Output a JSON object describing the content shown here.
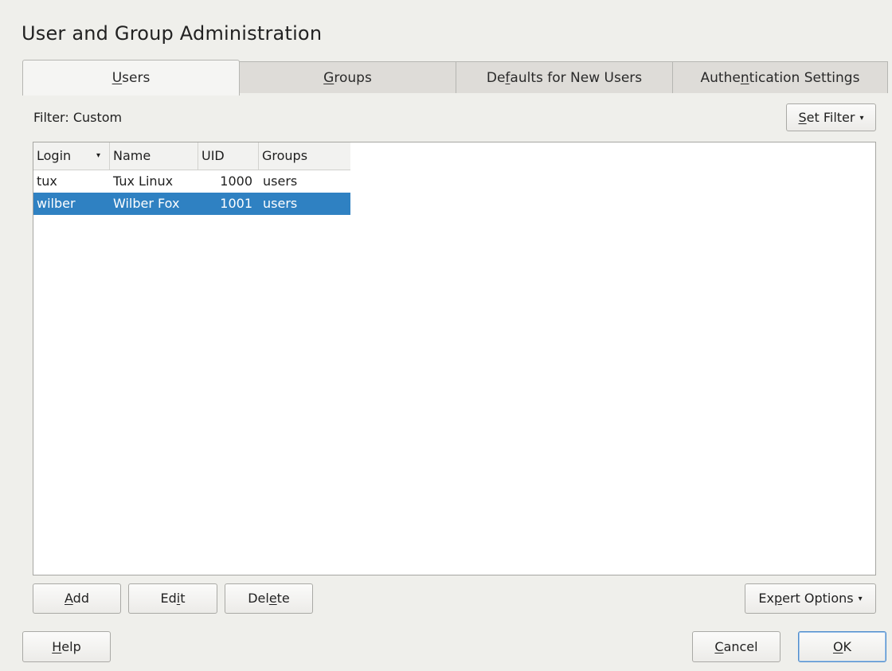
{
  "window": {
    "title": "User and Group Administration"
  },
  "tabs": [
    {
      "pre": "",
      "key": "U",
      "post": "sers",
      "active": true
    },
    {
      "pre": "",
      "key": "G",
      "post": "roups",
      "active": false
    },
    {
      "pre": "De",
      "key": "f",
      "post": "aults for New Users",
      "active": false
    },
    {
      "pre": "Authe",
      "key": "n",
      "post": "tication Settings",
      "active": false
    }
  ],
  "filter": {
    "label": "Filter: Custom",
    "button": {
      "pre": "",
      "key": "S",
      "post": "et Filter",
      "caret": "▾"
    }
  },
  "table": {
    "columns": [
      "Login",
      "Name",
      "UID",
      "Groups"
    ],
    "sort_indicator": "▾",
    "rows": [
      {
        "login": "tux",
        "name": "Tux Linux",
        "uid": "1000",
        "groups": "users",
        "selected": false
      },
      {
        "login": "wilber",
        "name": "Wilber Fox",
        "uid": "1001",
        "groups": "users",
        "selected": true
      }
    ]
  },
  "actions": {
    "add": {
      "pre": "",
      "key": "A",
      "post": "dd"
    },
    "edit": {
      "pre": "Ed",
      "key": "i",
      "post": "t"
    },
    "delete": {
      "pre": "Del",
      "key": "e",
      "post": "te"
    },
    "expert": {
      "pre": "Ex",
      "key": "p",
      "post": "ert Options",
      "caret": "▾"
    }
  },
  "footer": {
    "help": {
      "pre": "",
      "key": "H",
      "post": "elp"
    },
    "cancel": {
      "pre": "",
      "key": "C",
      "post": "ancel"
    },
    "ok": {
      "pre": "",
      "key": "O",
      "post": "K"
    }
  },
  "colors": {
    "selection": "#2f81c2",
    "background": "#efefeb",
    "default_button_border": "#4f8ccc"
  }
}
